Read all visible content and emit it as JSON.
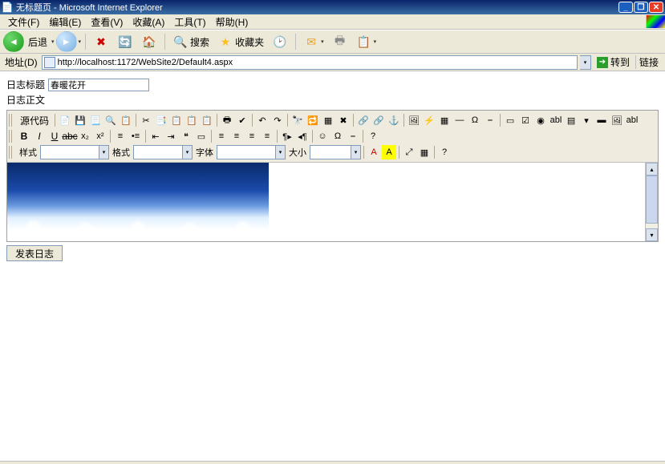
{
  "window": {
    "title": "无标题页 - Microsoft Internet Explorer"
  },
  "menu": {
    "file": "文件(F)",
    "edit": "编辑(E)",
    "view": "查看(V)",
    "favorites": "收藏(A)",
    "tools": "工具(T)",
    "help": "帮助(H)"
  },
  "nav": {
    "back": "后退",
    "search": "搜索",
    "favorites": "收藏夹"
  },
  "addr": {
    "label": "地址(D)",
    "url": "http://localhost:1172/WebSite2/Default4.aspx",
    "go": "转到",
    "links": "链接"
  },
  "form": {
    "title_label": "日志标题",
    "title_value": "春暖花开",
    "body_label": "日志正文",
    "submit": "发表日志"
  },
  "editor": {
    "source": "源代码",
    "style_label": "样式",
    "format_label": "格式",
    "font_label": "字体",
    "size_label": "大小",
    "style_value": "",
    "format_value": "",
    "font_value": "",
    "size_value": ""
  }
}
